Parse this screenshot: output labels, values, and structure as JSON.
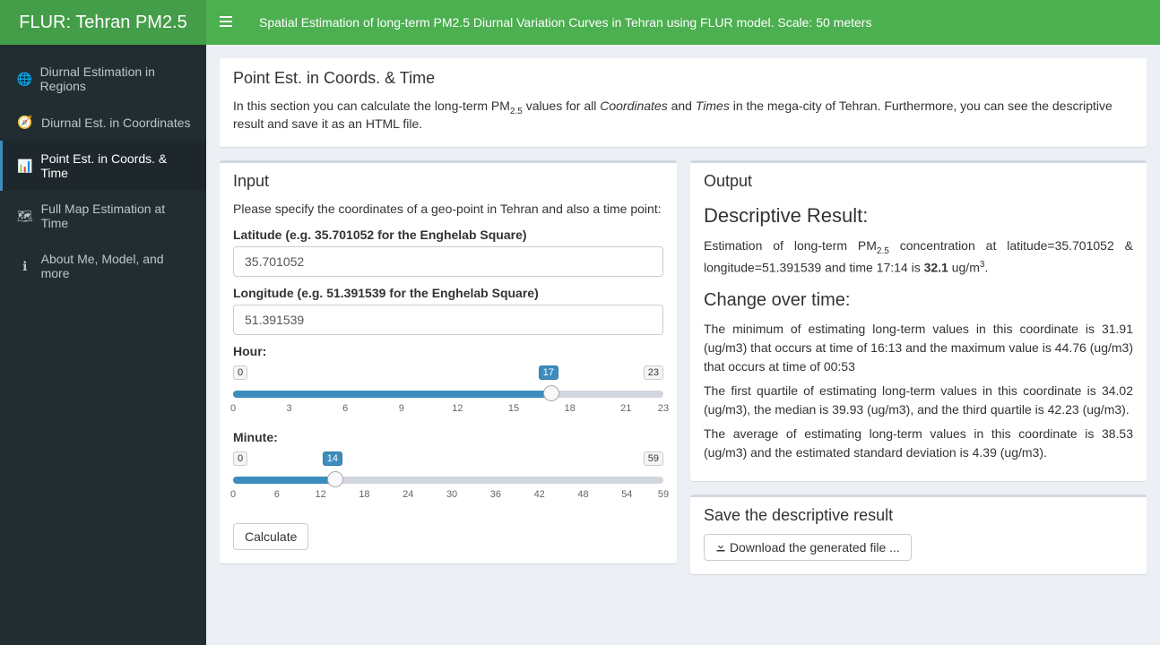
{
  "app": {
    "title": "FLUR: Tehran PM2.5",
    "header_text": "Spatial Estimation of long-term PM2.5 Diurnal Variation Curves in Tehran using FLUR model. Scale: 50 meters"
  },
  "sidebar": {
    "items": [
      {
        "icon": "globe",
        "label": "Diurnal Estimation in Regions"
      },
      {
        "icon": "compass",
        "label": "Diurnal Est. in Coordinates"
      },
      {
        "icon": "dashboard",
        "label": "Point Est. in Coords. & Time"
      },
      {
        "icon": "map",
        "label": "Full Map Estimation at Time"
      },
      {
        "icon": "info",
        "label": "About Me, Model, and more"
      }
    ],
    "active_index": 2
  },
  "intro": {
    "title": "Point Est. in Coords. & Time",
    "text_pre": "In this section you can calculate the long-term PM",
    "text_sub": "2.5",
    "text_mid": " values for all ",
    "text_coord": "Coordinates",
    "text_and": " and ",
    "text_times": "Times",
    "text_post": " in the mega-city of Tehran. Furthermore, you can see the descriptive result and save it as an HTML file."
  },
  "input": {
    "title": "Input",
    "prompt": "Please specify the coordinates of a geo-point in Tehran and also a time point:",
    "lat_label": "Latitude (e.g. 35.701052 for the Enghelab Square)",
    "lat_value": "35.701052",
    "lon_label": "Longitude (e.g. 51.391539 for the Enghelab Square)",
    "lon_value": "51.391539",
    "hour_label": "Hour:",
    "hour_min": "0",
    "hour_max": "23",
    "hour_value": "17",
    "hour_ticks": [
      "0",
      "3",
      "6",
      "9",
      "12",
      "15",
      "18",
      "21",
      "23"
    ],
    "minute_label": "Minute:",
    "minute_min": "0",
    "minute_max": "59",
    "minute_value": "14",
    "minute_ticks": [
      "0",
      "6",
      "12",
      "18",
      "24",
      "30",
      "36",
      "42",
      "48",
      "54",
      "59"
    ],
    "calc_label": "Calculate"
  },
  "output": {
    "title": "Output",
    "dr_heading": "Descriptive Result:",
    "result_pre": "Estimation of long-term PM",
    "result_sub": "2.5",
    "result_mid": " concentration at latitude=35.701052 & longitude=51.391539 and time 17:14 is ",
    "result_val": "32.1",
    "result_unit_pre": " ug/m",
    "result_unit_sup": "3",
    "result_unit_post": ".",
    "cot_heading": "Change over time:",
    "p1": "The minimum of estimating long-term values in this coordinate is 31.91 (ug/m3) that occurs at time of 16:13 and the maximum value is 44.76 (ug/m3) that occurs at time of 00:53",
    "p2": "The first quartile of estimating long-term values in this coordinate is 34.02 (ug/m3), the median is 39.93 (ug/m3), and the third quartile is 42.23 (ug/m3).",
    "p3": "The average of estimating long-term values in this coordinate is 38.53 (ug/m3) and the estimated standard deviation is 4.39 (ug/m3)."
  },
  "save": {
    "title": "Save the descriptive result",
    "download_label": "Download the generated file ..."
  }
}
